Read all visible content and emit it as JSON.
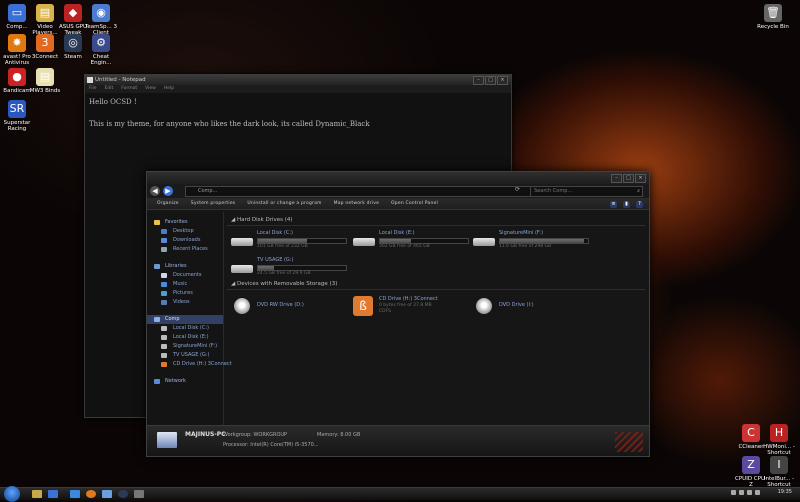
{
  "desktop": {
    "icons": [
      {
        "label": "Comp...",
        "glyph": "▭",
        "color": "#3b6fd6"
      },
      {
        "label": "Video Players...",
        "glyph": "▤",
        "color": "#d8b24a"
      },
      {
        "label": "ASUS GPU Tweak",
        "glyph": "◆",
        "color": "#b22"
      },
      {
        "label": "TeamSp... 3 Client",
        "glyph": "◉",
        "color": "#4a7bd0"
      },
      {
        "label": "avast! Pro Antivirus",
        "glyph": "✸",
        "color": "#e07a10"
      },
      {
        "label": "3Connect",
        "glyph": "3",
        "color": "#e06a20"
      },
      {
        "label": "Steam",
        "glyph": "◎",
        "color": "#2a3a55"
      },
      {
        "label": "Cheat Engin...",
        "glyph": "⚙",
        "color": "#3a4a8a"
      },
      {
        "label": "Bandicam",
        "glyph": "●",
        "color": "#c22"
      },
      {
        "label": "MW3 Binds",
        "glyph": "▤",
        "color": "#e8e0b0"
      },
      {
        "label": "Superstar Racing",
        "glyph": "SR",
        "color": "#2a58c0"
      },
      {
        "label": "Recycle Bin",
        "glyph": "🗑",
        "color": "#666"
      },
      {
        "label": "CCleaner",
        "glyph": "C",
        "color": "#c33"
      },
      {
        "label": "HWMoni... - Shortcut",
        "glyph": "H",
        "color": "#b22"
      },
      {
        "label": "CPUID CPU-Z",
        "glyph": "Z",
        "color": "#5a4aa0"
      },
      {
        "label": "IntelBur... - Shortcut",
        "glyph": "I",
        "color": "#444"
      }
    ]
  },
  "notepad": {
    "title": "Untitled - Notepad",
    "menu": [
      "File",
      "Edit",
      "Format",
      "View",
      "Help"
    ],
    "line1": "Hello OCSD !",
    "line2": "This is my theme, for anyone who likes the dark look, its called Dynamic_Black"
  },
  "explorer": {
    "address": "Comp...",
    "search_placeholder": "Search Comp...",
    "toolbar": [
      "Organize",
      "System properties",
      "Uninstall or change a program",
      "Map network drive",
      "Open Control Panel"
    ],
    "sidebar": {
      "favorites": "Favorites",
      "fav_items": [
        "Desktop",
        "Downloads",
        "Recent Places"
      ],
      "libraries": "Libraries",
      "lib_items": [
        "Documents",
        "Music",
        "Pictures",
        "Videos"
      ],
      "computer": "Comp",
      "comp_items": [
        "Local Disk (C:)",
        "Local Disk (E:)",
        "SignatureMini (F:)",
        "TV USAGE (G:)",
        "CD Drive (H:) 3Connect"
      ],
      "network": "Network"
    },
    "groups": {
      "hdd": "Hard Disk Drives (4)",
      "removable": "Devices with Removable Storage (3)"
    },
    "drives": [
      {
        "name": "Local Disk (C:)",
        "free": "101 GB free of 232 GB",
        "used": 0.56
      },
      {
        "name": "Local Disk (E:)",
        "free": "302 GB free of 465 GB",
        "used": 0.35
      },
      {
        "name": "SignatureMini (F:)",
        "free": "11.6 GB free of 298 GB",
        "used": 0.96
      },
      {
        "name": "TV USAGE (G:)",
        "free": "24.5 GB free of 29.9 GB",
        "used": 0.18
      }
    ],
    "removable": [
      {
        "name": "DVD RW Drive (D:)"
      },
      {
        "name": "CD Drive (H:) 3Connect",
        "free": "0 bytes free of 27.8 MB",
        "fs": "CDFS"
      },
      {
        "name": "DVD Drive (I:)"
      }
    ],
    "details": {
      "pc_name": "MAJINUS-PC",
      "workgroup_label": "Workgroup:",
      "workgroup": "WORKGROUP",
      "memory_label": "Memory:",
      "memory": "8.00 GB",
      "processor_label": "Processor:",
      "processor": "Intel(R) Core(TM) i5-3570..."
    }
  },
  "taskbar": {
    "clock": "19:35"
  }
}
